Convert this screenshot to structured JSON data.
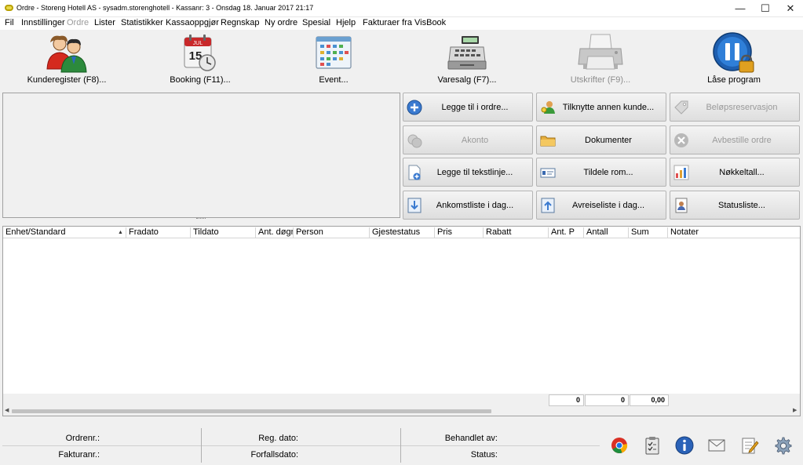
{
  "window": {
    "title": "Ordre - Storeng Hotell AS - sysadm.storenghotell - Kassanr: 3  - Onsdag 18. Januar 2017 21:17",
    "minimize": "—",
    "maximize": "☐",
    "close": "✕"
  },
  "menu": [
    {
      "label": "Fil"
    },
    {
      "label": "Innstillinger"
    },
    {
      "label": "Ordre"
    },
    {
      "label": "Lister"
    },
    {
      "label": "Statistikker"
    },
    {
      "label": "Kassaoppgjør"
    },
    {
      "label": "Regnskap"
    },
    {
      "label": "Ny ordre"
    },
    {
      "label": "Spesial"
    },
    {
      "label": "Hjelp"
    },
    {
      "label": "Fakturaer fra VisBook"
    }
  ],
  "toolbar": [
    {
      "label": "Kunderegister (F8)...",
      "icon": "customers-icon"
    },
    {
      "label": "Booking (F11)...",
      "icon": "calendar-clock-icon"
    },
    {
      "label": "Event...",
      "icon": "event-calendar-icon"
    },
    {
      "label": "Varesalg (F7)...",
      "icon": "cash-register-icon"
    },
    {
      "label": "Utskrifter (F9)...",
      "icon": "printer-icon"
    },
    {
      "label": "Låse program",
      "icon": "lock-pause-icon"
    }
  ],
  "actions": [
    {
      "label": "Legge til i ordre...",
      "icon": "add-circle-icon"
    },
    {
      "label": "Tilknytte annen kunde...",
      "icon": "link-customer-icon"
    },
    {
      "label": "Beløpsreservasjon",
      "icon": "tag-icon"
    },
    {
      "label": "Akonto",
      "icon": "coins-icon"
    },
    {
      "label": "Dokumenter",
      "icon": "folder-icon"
    },
    {
      "label": "Avbestille ordre",
      "icon": "cancel-icon"
    },
    {
      "label": "Legge til tekstlinje...",
      "icon": "add-text-line-icon"
    },
    {
      "label": "Tildele rom...",
      "icon": "assign-room-icon"
    },
    {
      "label": "Nøkkeltall...",
      "icon": "bar-chart-icon"
    },
    {
      "label": "Ankomstliste i dag...",
      "icon": "arrival-list-icon"
    },
    {
      "label": "Avreiseliste i dag...",
      "icon": "departure-list-icon"
    },
    {
      "label": "Statusliste...",
      "icon": "status-list-icon"
    }
  ],
  "grid": {
    "columns": [
      "Enhet/Standard",
      "Fradato",
      "Tildato",
      "Ant. døgn",
      "Person",
      "Gjestestatus",
      "Pris",
      "Rabatt",
      "Ant. P",
      "Antall",
      "Sum",
      "Notater"
    ],
    "rows": [],
    "totals": {
      "ant_p": "0",
      "antall": "0",
      "sum": "0,00"
    }
  },
  "footer": {
    "ordrenr_label": "Ordrenr.:",
    "fakturanr_label": "Fakturanr.:",
    "reg_dato_label": "Reg. dato:",
    "forfallsdato_label": "Forfallsdato:",
    "behandlet_av_label": "Behandlet av:",
    "status_label": "Status:",
    "icons": [
      "chrome-browser-icon",
      "clipboard-icon",
      "info-icon",
      "mail-icon",
      "notepad-icon",
      "settings-gear-icon"
    ]
  }
}
